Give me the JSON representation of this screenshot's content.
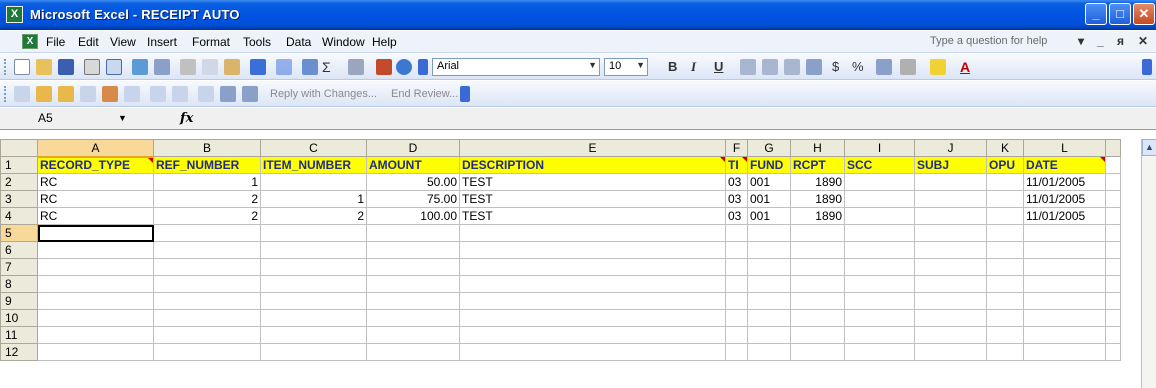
{
  "window": {
    "title": "Microsoft Excel - RECEIPT AUTO",
    "app_icon_text": "X",
    "min_label": "_",
    "max_label": "□",
    "close_label": "✕"
  },
  "menu": {
    "items": [
      "File",
      "Edit",
      "View",
      "Insert",
      "Format",
      "Tools",
      "Data",
      "Window",
      "Help"
    ],
    "help_placeholder": "Type a question for help",
    "right_controls": [
      "▾",
      "_",
      "ᴙ",
      "✕"
    ]
  },
  "format_toolbar": {
    "font_name": "Arial",
    "font_size": "10",
    "bold": "B",
    "italic": "I",
    "underline": "U",
    "currency": "$",
    "percent": "%"
  },
  "review_toolbar": {
    "reply_label": "Reply with Changes...",
    "end_review_label": "End Review..."
  },
  "formula_bar": {
    "name_box": "A5",
    "fx_label": "fx",
    "content": ""
  },
  "sheet": {
    "columns": [
      "A",
      "B",
      "C",
      "D",
      "E",
      "F",
      "G",
      "H",
      "I",
      "J",
      "K",
      "L"
    ],
    "selected_column": "A",
    "selected_row": "5",
    "header_row": [
      "RECORD_TYPE",
      "REF_NUMBER",
      "ITEM_NUMBER",
      "AMOUNT",
      "DESCRIPTION",
      "TI",
      "FUND",
      "RCPT",
      "SCC",
      "SUBJ",
      "OPU",
      "DATE"
    ],
    "rows": [
      {
        "num": "2",
        "cells": [
          "RC",
          "1",
          "",
          "50.00",
          "TEST",
          "03",
          "001",
          "1890",
          "",
          "",
          "",
          "11/01/2005"
        ]
      },
      {
        "num": "3",
        "cells": [
          "RC",
          "2",
          "1",
          "75.00",
          "TEST",
          "03",
          "001",
          "1890",
          "",
          "",
          "",
          "11/01/2005"
        ]
      },
      {
        "num": "4",
        "cells": [
          "RC",
          "2",
          "2",
          "100.00",
          "TEST",
          "03",
          "001",
          "1890",
          "",
          "",
          "",
          "11/01/2005"
        ]
      }
    ],
    "empty_rows": [
      "5",
      "6",
      "7",
      "8",
      "9",
      "10",
      "11",
      "12"
    ],
    "row_header_1": "1"
  },
  "colors": {
    "header_fill": "#ffff00",
    "header_text": "#1f2c8c",
    "titlebar_blue": "#0054e3",
    "comment_marker": "#d00000"
  }
}
